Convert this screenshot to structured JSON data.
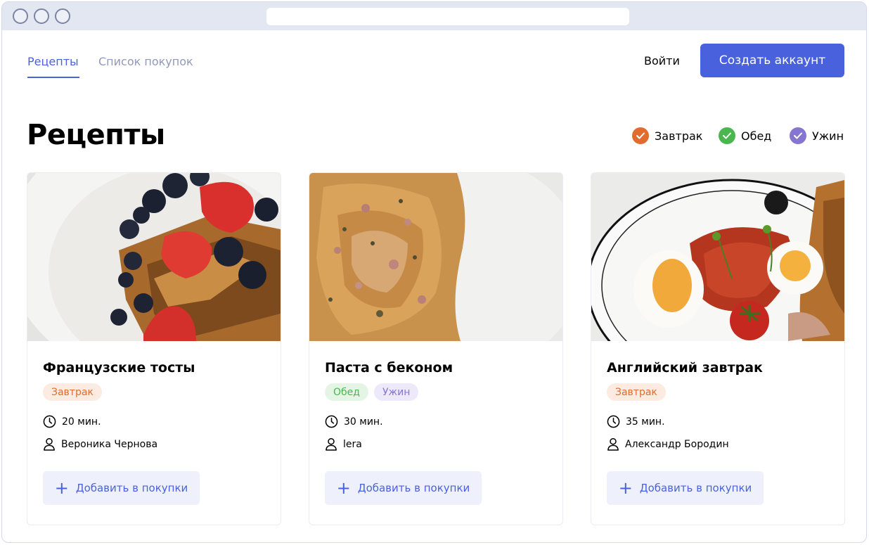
{
  "nav": {
    "tabs": [
      {
        "label": "Рецепты",
        "active": true
      },
      {
        "label": "Список покупок",
        "active": false
      }
    ],
    "login_label": "Войти",
    "create_account_label": "Создать аккаунт"
  },
  "page": {
    "title": "Рецепты"
  },
  "filters": [
    {
      "label": "Завтрак",
      "color": "#e26c2d"
    },
    {
      "label": "Обед",
      "color": "#49b64e"
    },
    {
      "label": "Ужин",
      "color": "#8775d2"
    }
  ],
  "cards": [
    {
      "title": "Французские тосты",
      "tags": [
        {
          "label": "Завтрак",
          "text_color": "#e26c2d",
          "bg": "#fcebe1"
        }
      ],
      "time": "20 мин.",
      "author": "Вероника Чернова",
      "add_label": "Добавить в покупки",
      "image": "french-toast-with-strawberries-and-blueberries"
    },
    {
      "title": "Паста с беконом",
      "tags": [
        {
          "label": "Обед",
          "text_color": "#49b64e",
          "bg": "#e4f5e5"
        },
        {
          "label": "Ужин",
          "text_color": "#8775d2",
          "bg": "#ede9fa"
        }
      ],
      "time": "30 мин.",
      "author": "lera",
      "add_label": "Добавить в покупки",
      "image": "fusilli-pasta-with-bacon"
    },
    {
      "title": "Английский завтрак",
      "tags": [
        {
          "label": "Завтрак",
          "text_color": "#e26c2d",
          "bg": "#fcebe1"
        }
      ],
      "time": "35 мин.",
      "author": "Александр Бородин",
      "add_label": "Добавить в покупки",
      "image": "english-breakfast-plate"
    }
  ],
  "icons": {
    "time": "clock-icon",
    "author": "user-icon",
    "add": "plus-icon",
    "filter_check": "check-icon"
  },
  "colors": {
    "accent": "#4a61dd",
    "accent_light": "#eef1fc",
    "muted": "#9199b8"
  }
}
